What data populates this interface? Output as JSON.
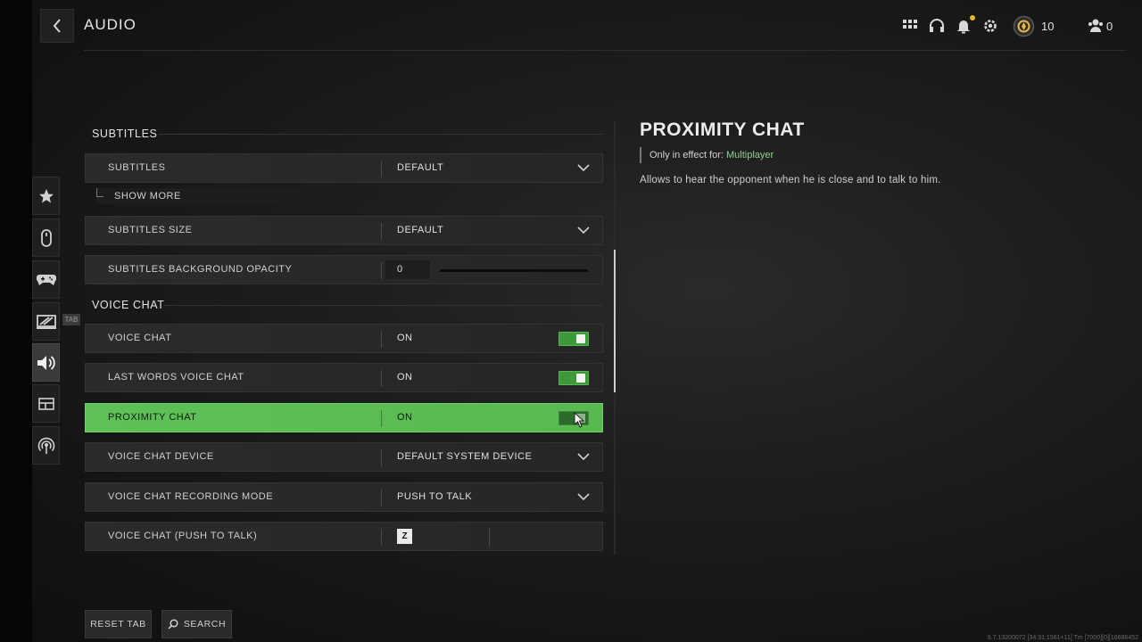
{
  "header": {
    "title": "AUDIO",
    "currency_count": "10",
    "players_count": "0"
  },
  "side_nav": {
    "tab_hint": "TAB",
    "items": [
      {
        "icon": "star-icon"
      },
      {
        "icon": "mouse-icon"
      },
      {
        "icon": "controller-icon"
      },
      {
        "icon": "display-icon"
      },
      {
        "icon": "speaker-icon",
        "active": true
      },
      {
        "icon": "interface-icon"
      },
      {
        "icon": "network-icon"
      }
    ]
  },
  "sections": {
    "subtitles": "SUBTITLES",
    "voice_chat": "VOICE CHAT"
  },
  "settings": {
    "subtitles": {
      "label": "SUBTITLES",
      "value": "DEFAULT"
    },
    "show_more": "SHOW MORE",
    "subtitles_size": {
      "label": "SUBTITLES SIZE",
      "value": "DEFAULT"
    },
    "subtitles_bg_opacity": {
      "label": "SUBTITLES BACKGROUND OPACITY",
      "value": "0"
    },
    "voice_chat": {
      "label": "VOICE CHAT",
      "value": "ON"
    },
    "last_words": {
      "label": "LAST WORDS VOICE CHAT",
      "value": "ON"
    },
    "proximity": {
      "label": "PROXIMITY CHAT",
      "value": "ON"
    },
    "device": {
      "label": "VOICE CHAT DEVICE",
      "value": "DEFAULT SYSTEM DEVICE"
    },
    "recording_mode": {
      "label": "VOICE CHAT RECORDING MODE",
      "value": "PUSH TO TALK"
    },
    "push_to_talk": {
      "label": "VOICE CHAT (PUSH TO TALK)",
      "key": "Z"
    }
  },
  "detail": {
    "title": "PROXIMITY CHAT",
    "scope_prefix": "Only in effect for:",
    "scope_mode": "Multiplayer",
    "description": "Allows to hear the opponent when he is close and to talk to him."
  },
  "bottom": {
    "reset": "RESET TAB",
    "search": "SEARCH"
  },
  "build_info": "9.7.13200072 [34:31:1561+11] Tm [7000][0][16686452",
  "colors": {
    "accent_green": "#5ec157",
    "notification": "#f0b429"
  }
}
